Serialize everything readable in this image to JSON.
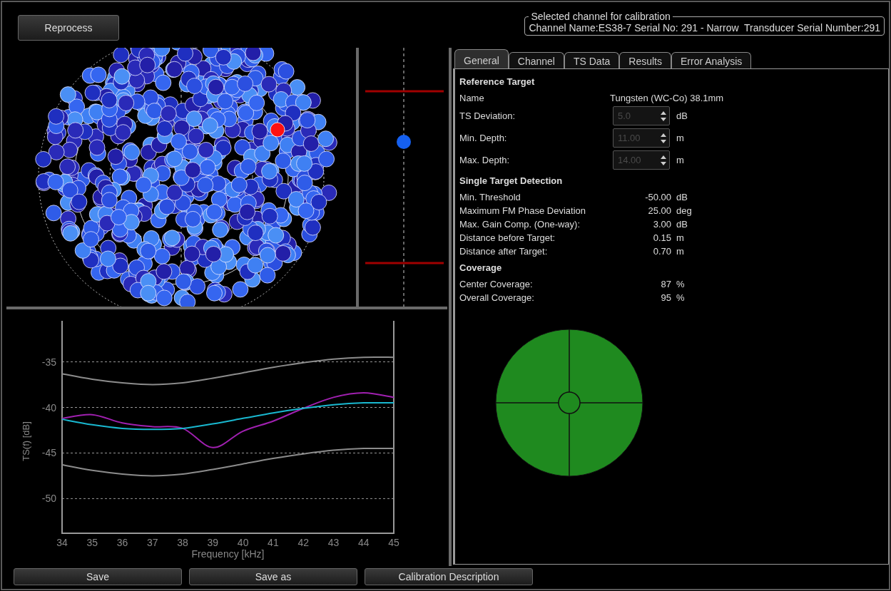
{
  "toolbar": {
    "reprocess_button": "Reprocess"
  },
  "selected_channel": {
    "title": "Selected channel for calibration",
    "text": "Channel Name:ES38-7 Serial No: 291 - Narrow  Transducer Serial Number:291"
  },
  "tabs": [
    {
      "label": "General",
      "selected": true
    },
    {
      "label": "Channel",
      "selected": false
    },
    {
      "label": "TS Data",
      "selected": false
    },
    {
      "label": "Results",
      "selected": false
    },
    {
      "label": "Error Analysis",
      "selected": false
    }
  ],
  "general": {
    "sections": [
      {
        "heading": "Reference Target",
        "rows": [
          {
            "kind": "text",
            "label": "Name",
            "value": "Tungsten (WC-Co) 38.1mm"
          },
          {
            "kind": "spin",
            "label": "TS Deviation:",
            "value": "5.0",
            "unit": "dB",
            "disabled": true
          },
          {
            "kind": "spin",
            "label": "Min. Depth:",
            "value": "11.00",
            "unit": "m",
            "disabled": true
          },
          {
            "kind": "spin",
            "label": "Max. Depth:",
            "value": "14.00",
            "unit": "m",
            "disabled": true
          }
        ]
      },
      {
        "heading": "Single Target Detection",
        "rows": [
          {
            "kind": "reading",
            "label": "Min. Threshold",
            "value": "-50.00",
            "unit": "dB"
          },
          {
            "kind": "reading",
            "label": "Maximum FM Phase Deviation",
            "value": "25.00",
            "unit": "deg"
          },
          {
            "kind": "reading",
            "label": "Max. Gain Comp. (One-way):",
            "value": "3.00",
            "unit": "dB"
          },
          {
            "kind": "reading",
            "label": "Distance before Target:",
            "value": "0.15",
            "unit": "m"
          },
          {
            "kind": "reading",
            "label": "Distance after Target:",
            "value": "0.70",
            "unit": "m"
          }
        ]
      },
      {
        "heading": "Coverage",
        "rows": [
          {
            "kind": "reading",
            "label": "Center Coverage:",
            "value": "87",
            "unit": "%"
          },
          {
            "kind": "reading",
            "label": "Overall Coverage:",
            "value": "95",
            "unit": "%"
          }
        ]
      }
    ]
  },
  "ts_chart": {
    "chart_data": {
      "type": "line",
      "xlabel": "Frequency [kHz]",
      "ylabel": "TS(f) [dB]",
      "x": [
        34,
        35,
        36,
        37,
        38,
        39,
        40,
        41,
        42,
        43,
        44,
        45
      ],
      "series": [
        {
          "color": "#8c8c8c",
          "values": [
            -36.3,
            -36.9,
            -37.3,
            -37.5,
            -37.3,
            -36.8,
            -36.2,
            -35.6,
            -35.1,
            -34.7,
            -34.5,
            -34.5
          ]
        },
        {
          "color": "#8c8c8c",
          "values": [
            -46.3,
            -46.9,
            -47.3,
            -47.5,
            -47.3,
            -46.8,
            -46.2,
            -45.6,
            -45.1,
            -44.7,
            -44.5,
            -44.5
          ]
        },
        {
          "color": "#a020b0",
          "values": [
            -41.2,
            -40.8,
            -41.7,
            -42.1,
            -42.3,
            -44.4,
            -42.6,
            -41.5,
            -40.1,
            -38.9,
            -38.4,
            -38.9
          ]
        },
        {
          "color": "#19b8d0",
          "values": [
            -41.3,
            -41.9,
            -42.3,
            -42.4,
            -42.3,
            -41.8,
            -41.2,
            -40.6,
            -40.1,
            -39.7,
            -39.5,
            -39.5
          ]
        }
      ],
      "xlim": [
        34,
        45
      ],
      "ylim": [
        -53.8,
        -30.5
      ],
      "xticks": [
        34,
        35,
        36,
        37,
        38,
        39,
        40,
        41,
        42,
        43,
        44,
        45
      ],
      "yticks": [
        -35,
        -40,
        -45,
        -50
      ],
      "grid": true
    }
  },
  "bottom_buttons": [
    "Save",
    "Save as",
    "Calibration Description"
  ]
}
